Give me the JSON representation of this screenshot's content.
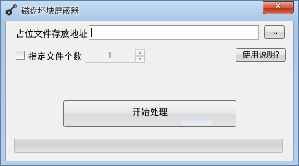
{
  "window": {
    "title": "磁盘坏块屏蔽器",
    "close_label": "✕"
  },
  "form": {
    "path_label": "占位文件存放地址",
    "path_value": "",
    "browse_label": "...",
    "count_label": "指定文件个数",
    "count_checked": false,
    "count_value": "1",
    "help_label": "使用说明?",
    "start_label": "开始处理"
  },
  "progress": {
    "fraction": 0
  },
  "icons": {
    "app": "disk-wrench-icon",
    "spin_up": "spin-up-arrow-icon",
    "spin_down": "spin-down-arrow-icon"
  }
}
